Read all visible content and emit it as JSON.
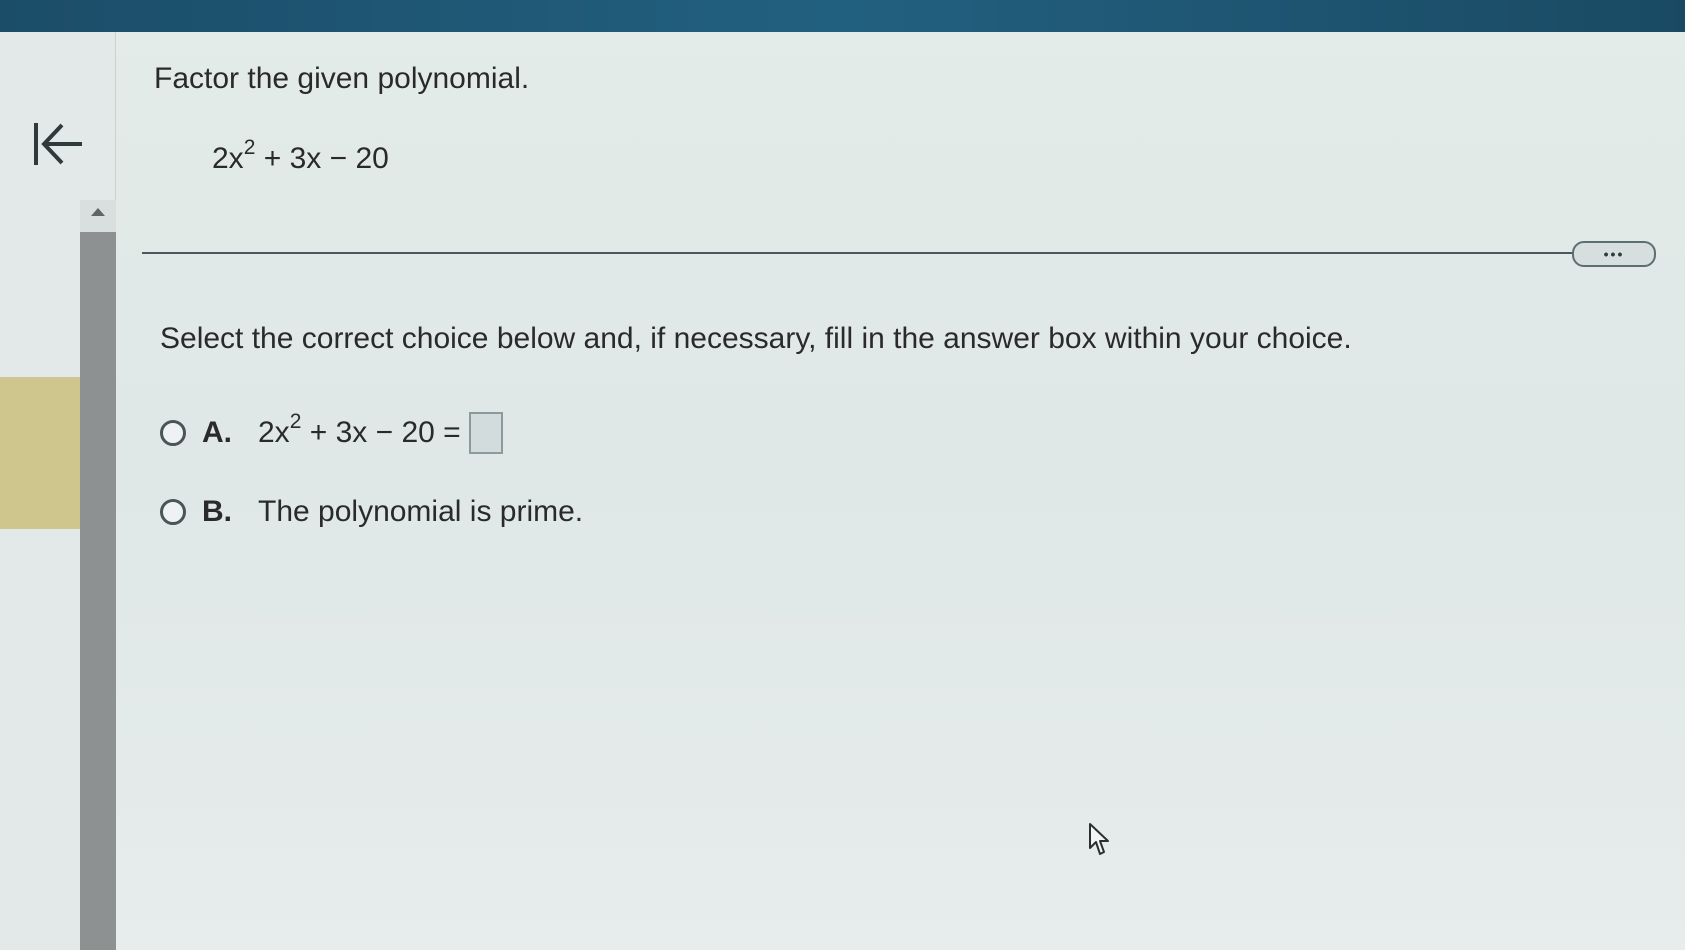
{
  "question": {
    "title": "Factor the given polynomial.",
    "polynomial": {
      "lead": "2x",
      "exponent": "2",
      "rest": " + 3x − 20"
    }
  },
  "instruction": "Select the correct choice below and, if necessary, fill in the answer box within your choice.",
  "choices": [
    {
      "letter": "A.",
      "expr_lead": "2x",
      "expr_exponent": "2",
      "expr_rest": " + 3x − 20 ="
    },
    {
      "letter": "B.",
      "text": "The polynomial is prime."
    }
  ],
  "more_button": {
    "label": "•••"
  },
  "icons": {
    "back": "back-to-start-arrow-icon",
    "scroll_up": "scroll-up-triangle-icon",
    "cursor": "mouse-pointer-hand-icon"
  },
  "colors": {
    "top_bar": "#1f5674",
    "text": "#2a2a2a",
    "accent_strip": "#cfc68e",
    "scroll_thumb": "#8e9191"
  }
}
